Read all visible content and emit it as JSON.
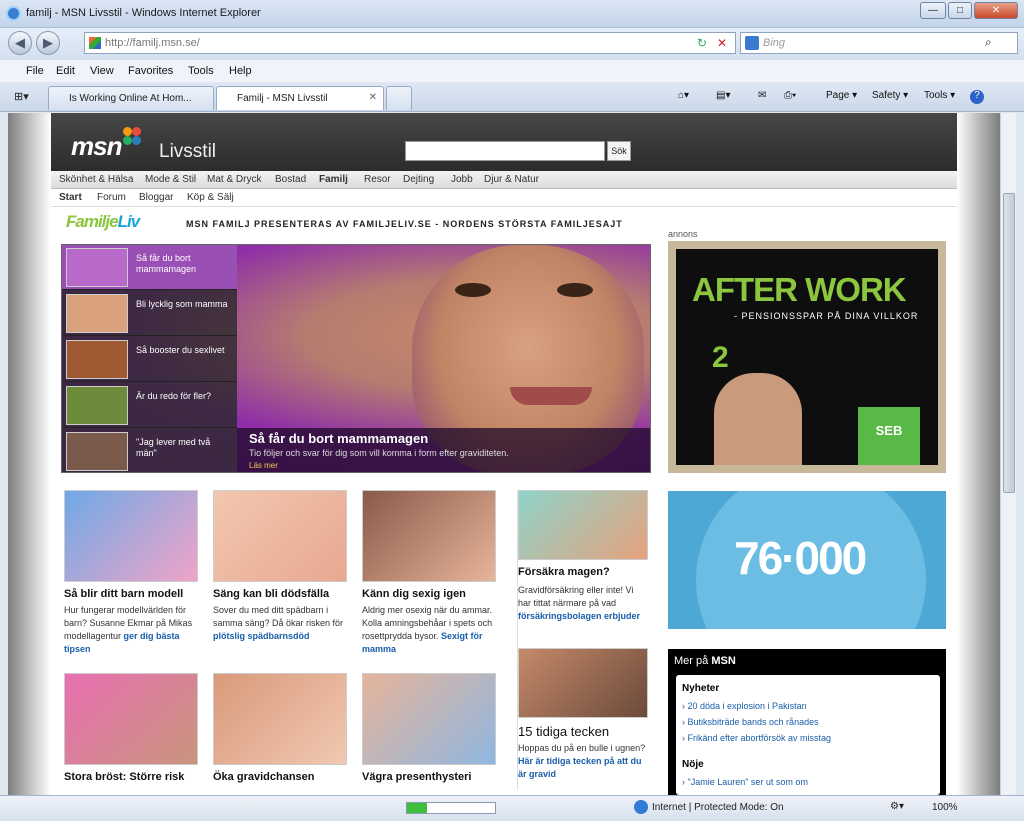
{
  "window": {
    "title": "familj - MSN Livsstil - Windows Internet Explorer",
    "min": "—",
    "max": "□",
    "close": "✕"
  },
  "address": {
    "url": "http://familj.msn.se/",
    "refresh": "↻",
    "stop": "✕"
  },
  "search": {
    "placeholder": "Bing"
  },
  "menu": [
    "File",
    "Edit",
    "View",
    "Favorites",
    "Tools",
    "Help"
  ],
  "tabs": [
    {
      "label": "Is Working Online At Hom..."
    },
    {
      "label": "Familj - MSN Livsstil"
    }
  ],
  "commands": [
    "Page ▾",
    "Safety ▾",
    "Tools ▾",
    "?"
  ],
  "status": {
    "zone": "Internet | Protected Mode: On",
    "zoom": "100%"
  },
  "site": {
    "logo": "msn",
    "section": "Livsstil",
    "search_button": "Sök",
    "nav_primary": [
      "Skönhet & Hälsa",
      "Mode & Stil",
      "Mat & Dryck",
      "Bostad",
      "Familj",
      "Resor",
      "Dejting",
      "Jobb",
      "Djur & Natur"
    ],
    "nav_secondary": [
      "Start",
      "Forum",
      "Bloggar",
      "Köp & Sälj"
    ],
    "brand": {
      "part1": "Familje",
      "part2": "Liv"
    },
    "tagline": "MSN FAMILJ PRESENTERAS AV FAMILJELIV.SE - NORDENS STÖRSTA FAMILJESAJT",
    "ad_label": "annons",
    "hero": {
      "items": [
        "Så får du bort mammamagen",
        "Bli lycklig som mamma",
        "Så booster du sexlivet",
        "Är du redo för fler?",
        "\"Jag lever med två män\""
      ],
      "caption_title": "Så får du bort mammamagen",
      "caption_sub": "Tio följer och svar för dig som vill komma i form efter graviditeten.",
      "caption_more": "Läs mer"
    },
    "ad_afterwork": {
      "title": "AFTER WORK",
      "sub": "- PENSIONSSPAR PÅ DINA VILLKOR",
      "number": "2",
      "brand": "SEB"
    },
    "ad_number": "76·000",
    "more_msn": {
      "title_prefix": "Mer på",
      "title_brand": "MSN",
      "news_head": "Nyheter",
      "news": [
        "20 döda i explosion i Pakistan",
        "Butiksbiträde bands och rånades",
        "Frikänd efter abortförsök av misstag"
      ],
      "noje_head": "Nöje",
      "noje": [
        "\"Jamie Lauren\" ser ut som om"
      ]
    },
    "cards": [
      {
        "title": "Så blir ditt barn modell",
        "body": "Hur fungerar modellvärlden för barn? Susanne Ekmar på Mikas modellagentur ",
        "link": "ger dig bästa tipsen"
      },
      {
        "title": "Säng kan bli dödsfälla",
        "body": "Sover du med ditt spädbarn i samma säng? Då ökar risken för ",
        "link": "plötslig spädbarnsdöd"
      },
      {
        "title": "Känn dig sexig igen",
        "body": "Aldrig mer osexig när du ammar. Kolla amningsbehåar i spets och rosettprydda bysor. ",
        "link": "Sexigt för mamma"
      },
      {
        "title": "Försäkra magen?",
        "body": "Gravidförsäkring eller inte! Vi har tittat närmare på vad ",
        "link": "försäkringsbolagen erbjuder"
      },
      {
        "title": "15 tidiga tecken",
        "body": "Hoppas du på en bulle i ugnen? ",
        "link": "Här är tidiga tecken på att du är gravid"
      },
      {
        "title": "Stora bröst: Större risk",
        "body": "",
        "link": ""
      },
      {
        "title": "Öka gravidchansen",
        "body": "",
        "link": ""
      },
      {
        "title": "Vägra presenthysteri",
        "body": "",
        "link": ""
      }
    ]
  }
}
